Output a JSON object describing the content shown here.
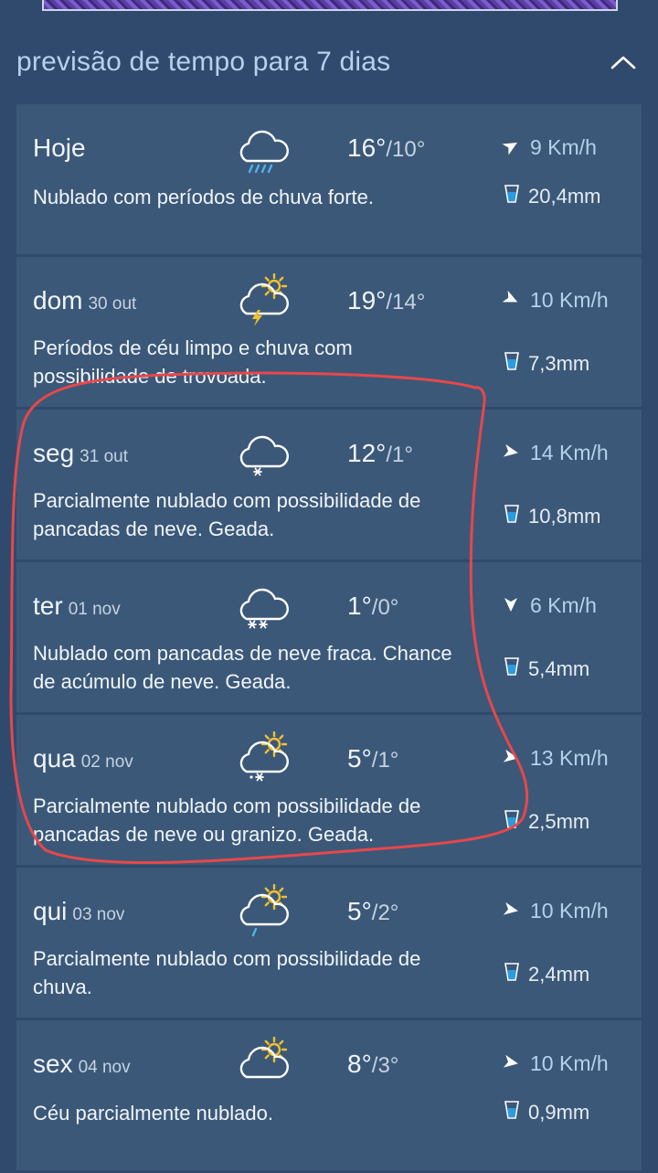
{
  "section": {
    "title": "previsão de tempo para 7 dias"
  },
  "days": [
    {
      "day": "Hoje",
      "date": "",
      "icon": "cloud-heavy-rain-icon",
      "max": "16°",
      "min": "10°",
      "wind": "9 Km/h",
      "wind_dir_deg": 60,
      "desc": "Nublado com períodos de chuva forte.",
      "rain": "20,4mm"
    },
    {
      "day": "dom",
      "date": "30 out",
      "icon": "sun-cloud-thunder-icon",
      "max": "19°",
      "min": "14°",
      "wind": "10 Km/h",
      "wind_dir_deg": 115,
      "desc": "Períodos de céu limpo e chuva com possibilidade de trovoada.",
      "rain": "7,3mm"
    },
    {
      "day": "seg",
      "date": "31 out",
      "icon": "cloud-snow-icon",
      "max": "12°",
      "min": "1°",
      "wind": "14 Km/h",
      "wind_dir_deg": 100,
      "desc": "Parcialmente nublado com possibilidade de pancadas de neve. Geada.",
      "rain": "10,8mm"
    },
    {
      "day": "ter",
      "date": "01 nov",
      "icon": "cloud-heavy-snow-icon",
      "max": "1°",
      "min": "0°",
      "wind": "6 Km/h",
      "wind_dir_deg": 180,
      "desc": "Nublado com pancadas de neve fraca. Chance de acúmulo de neve. Geada.",
      "rain": "5,4mm"
    },
    {
      "day": "qua",
      "date": "02 nov",
      "icon": "sun-cloud-snow-icon",
      "max": "5°",
      "min": "1°",
      "wind": "13 Km/h",
      "wind_dir_deg": 100,
      "desc": "Parcialmente nublado com possibilidade de pancadas de neve ou granizo. Geada.",
      "rain": "2,5mm"
    },
    {
      "day": "qui",
      "date": "03 nov",
      "icon": "sun-cloud-rain-icon",
      "max": "5°",
      "min": "2°",
      "wind": "10 Km/h",
      "wind_dir_deg": 100,
      "desc": "Parcialmente nublado com possibilidade de chuva.",
      "rain": "2,4mm"
    },
    {
      "day": "sex",
      "date": "04 nov",
      "icon": "sun-cloud-icon",
      "max": "8°",
      "min": "3°",
      "wind": "10 Km/h",
      "wind_dir_deg": 100,
      "desc": "Céu parcialmente nublado.",
      "rain": "0,9mm"
    }
  ],
  "colors": {
    "background": "#2f4a6c",
    "row": "#3b5878",
    "accent": "#b6d1ee",
    "annotation": "#e8474a"
  }
}
